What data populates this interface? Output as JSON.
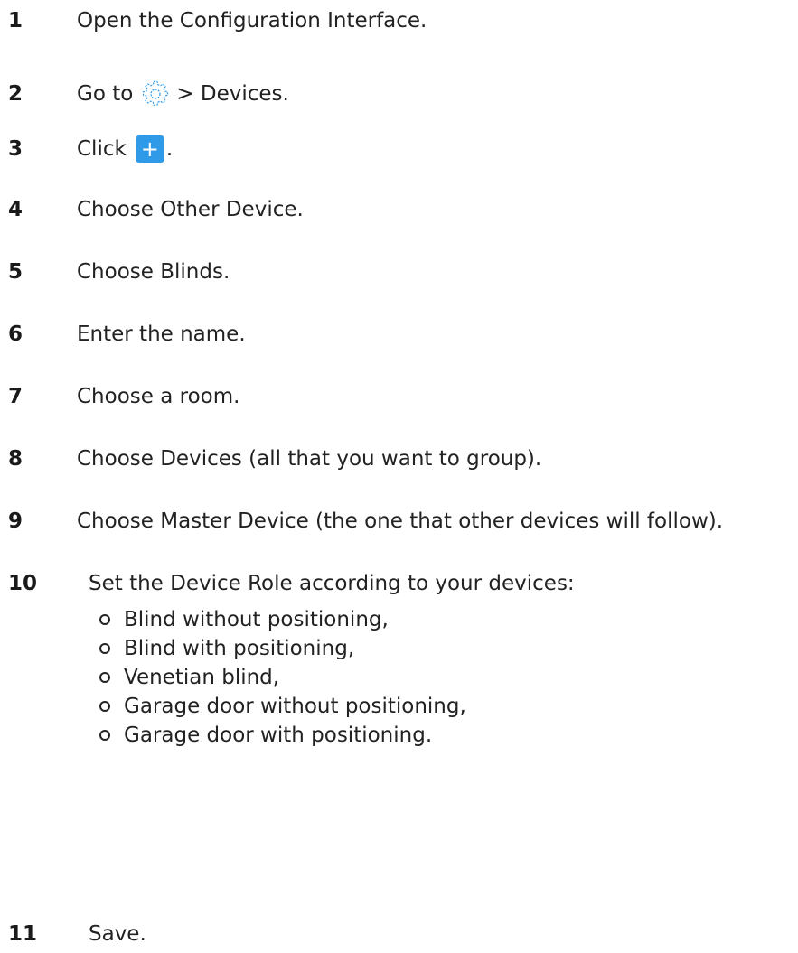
{
  "steps": [
    {
      "num": "1",
      "text": "Open the Configuration Interface."
    },
    {
      "num": "2",
      "text_before": "Go to",
      "icon": "gear-icon",
      "text_after": "> Devices."
    },
    {
      "num": "3",
      "text_before": "Click",
      "button_glyph": "+",
      "button_color": "#2f9ae8",
      "text_after": "."
    },
    {
      "num": "4",
      "text": "Choose Other Device."
    },
    {
      "num": "5",
      "text": "Choose Blinds."
    },
    {
      "num": "6",
      "text": "Enter the name."
    },
    {
      "num": "7",
      "text": "Choose a room."
    },
    {
      "num": "8",
      "text": "Choose Devices (all that you want to group)."
    },
    {
      "num": "9",
      "text": "Choose Master Device (the one that other devices will follow)."
    },
    {
      "num": "10",
      "text": "Set the Device Role according to your devices:",
      "options": [
        "Blind without positioning,",
        "Blind with positioning,",
        "Venetian blind,",
        "Garage door without positioning,",
        "Garage door with positioning."
      ]
    },
    {
      "num": "11",
      "text": "Save."
    }
  ]
}
